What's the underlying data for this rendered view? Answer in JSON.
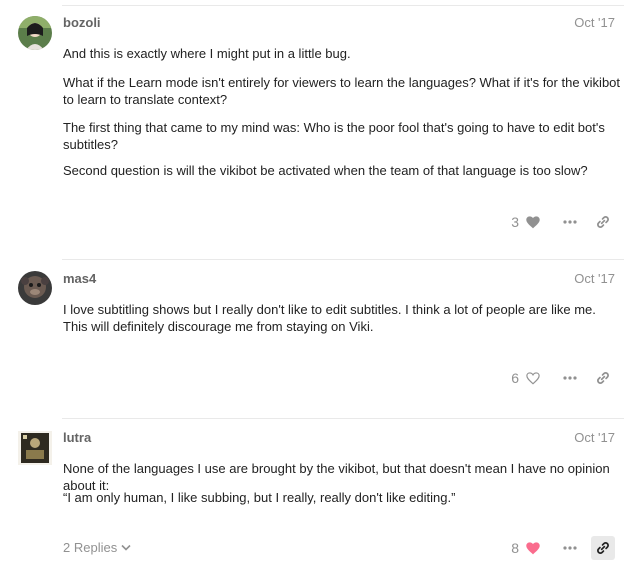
{
  "posts": [
    {
      "username": "bozoli",
      "date": "Oct '17",
      "paragraphs": [
        "And this is exactly where I might put in a little bug.",
        "What if the Learn mode isn't entirely for viewers to learn the languages? What if it's for the vikibot to learn to translate context?",
        "The first thing that came to my mind was: Who is the poor fool that's going to have to edit bot's subtitles?",
        "Second question is will the vikibot be activated when the team of that language is too slow?"
      ],
      "like_count": "3",
      "liked": false
    },
    {
      "username": "mas4",
      "date": "Oct '17",
      "paragraphs": [
        "I love subtitling shows but I really don't like to edit subtitles. I think a lot of people are like me. This will definitely discourage me from staying on Viki."
      ],
      "like_count": "6",
      "liked": false
    },
    {
      "username": "lutra",
      "date": "Oct '17",
      "paragraphs": [
        "None of the languages I use are brought by the vikibot, but that doesn't mean I have no opinion about it:",
        "“I am only human, I like subbing, but I really, really don't like editing.”"
      ],
      "replies_label": "2 Replies",
      "like_count": "8",
      "liked": true
    }
  ],
  "colors": {
    "muted": "#919191",
    "heart_liked": "#fa6c8d",
    "heart_grey": "#919191"
  },
  "icons": {
    "heart": "heart-icon",
    "more": "ellipsis-icon",
    "link": "link-icon",
    "chevron": "chevron-down-icon"
  }
}
